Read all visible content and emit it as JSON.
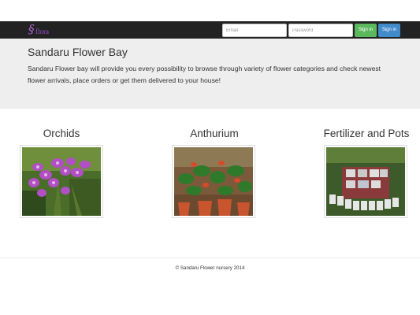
{
  "navbar": {
    "brand_text": "flora",
    "email_placeholder": "Email",
    "password_placeholder": "Password",
    "signin_green_label": "Sign in",
    "signin_blue_label": "Sign in"
  },
  "jumbotron": {
    "title": "Sandaru Flower Bay",
    "text": "Sandaru Flower bay will provide you every possibility to browse through variety of flower categories and check newest flower arrivals, place orders or get them delivered to your house!"
  },
  "categories": [
    {
      "title": "Orchids"
    },
    {
      "title": "Anthurium"
    },
    {
      "title": "Fertilizer and Pots"
    }
  ],
  "footer": {
    "copyright": "© Sandaru Flower nursery 2014"
  },
  "colors": {
    "navbar_bg": "#222222",
    "jumbotron_bg": "#eeeeee",
    "signin_green": "#5cb85c",
    "signin_blue": "#428bca",
    "brand": "#9b4fd0"
  }
}
